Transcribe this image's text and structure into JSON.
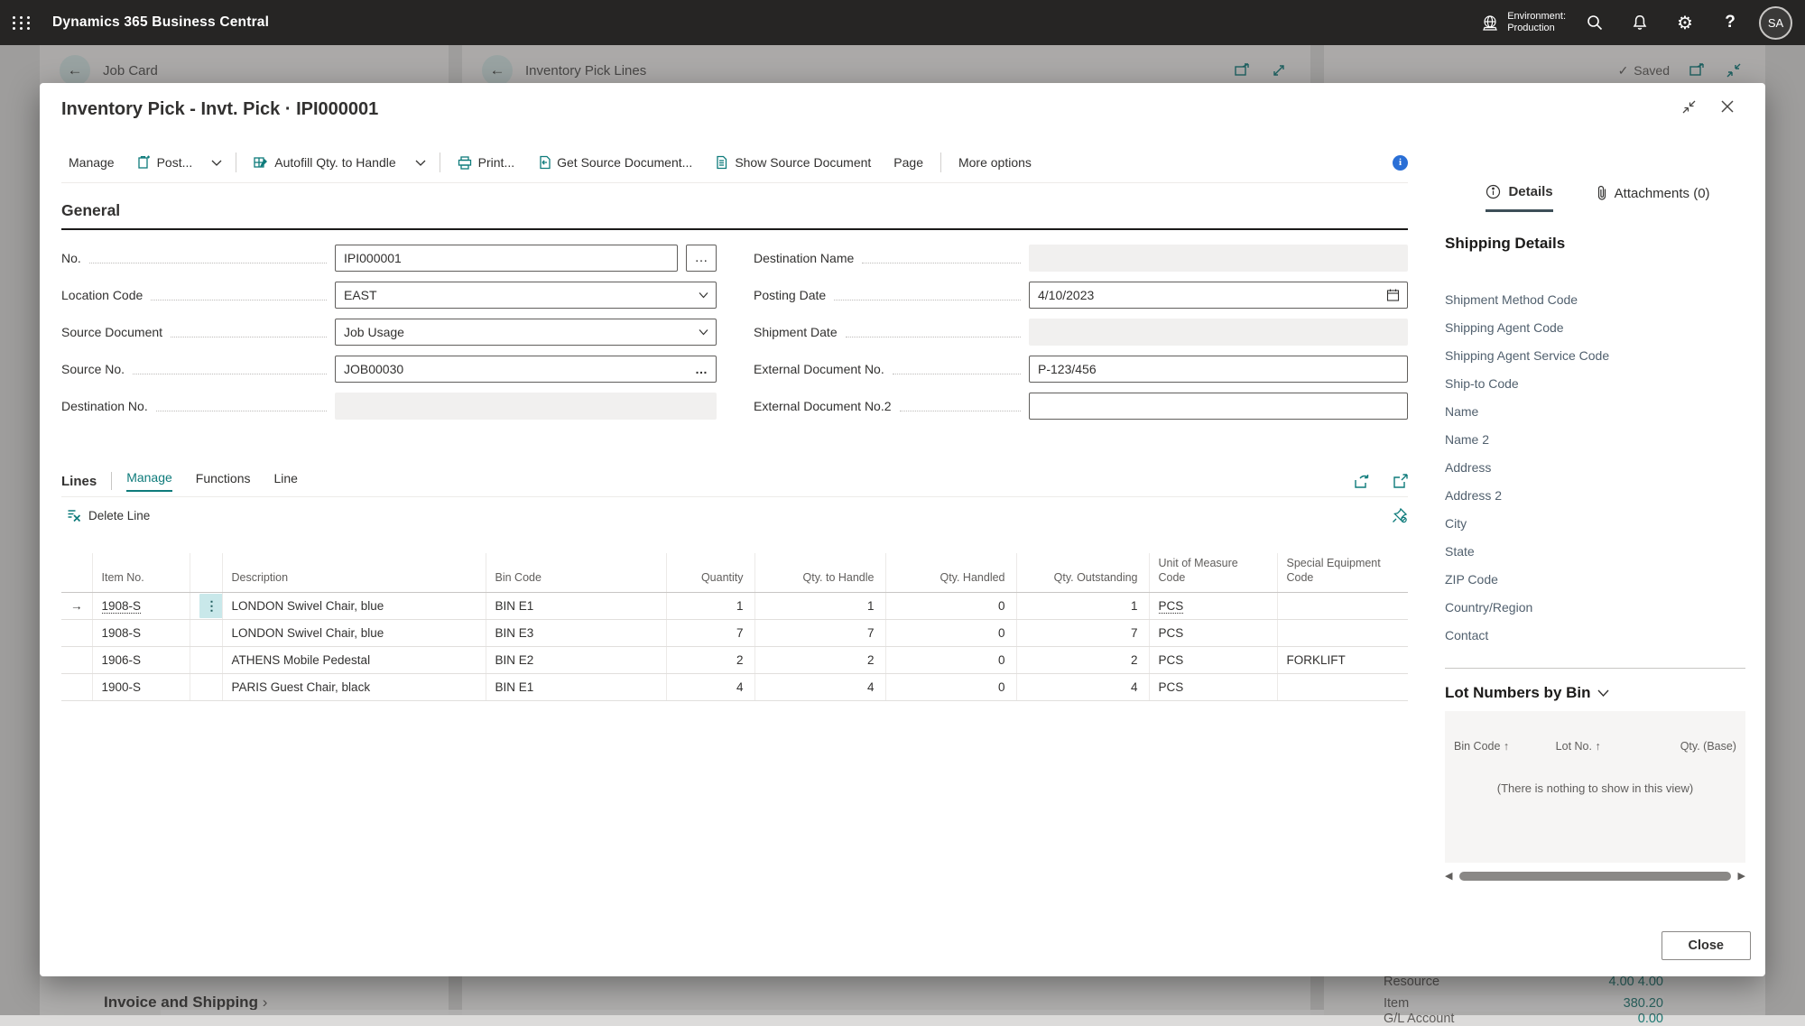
{
  "topbar": {
    "app_title": "Dynamics 365 Business Central",
    "environment_label": "Environment:",
    "environment_name": "Production",
    "avatar_initials": "SA"
  },
  "background": {
    "left_page_title": "Job Card",
    "middle_page_title": "Inventory Pick Lines",
    "saved_indicator": "Saved",
    "left_bottom_section": "Invoice and Shipping",
    "fact_rows": [
      {
        "label": "Resource",
        "value": "4.00 4.00"
      },
      {
        "label": "Item",
        "value": "380.20"
      },
      {
        "label": "G/L Account",
        "value": "0.00"
      }
    ]
  },
  "modal": {
    "title": "Inventory Pick - Invt. Pick · IPI000001",
    "toolbar": {
      "manage": "Manage",
      "post": "Post...",
      "autofill": "Autofill Qty. to Handle",
      "print": "Print...",
      "get_source": "Get Source Document...",
      "show_source": "Show Source Document",
      "page": "Page",
      "more_options": "More options"
    },
    "general": {
      "heading": "General",
      "fields": {
        "no": {
          "label": "No.",
          "value": "IPI000001"
        },
        "location_code": {
          "label": "Location Code",
          "value": "EAST"
        },
        "source_document": {
          "label": "Source Document",
          "value": "Job Usage"
        },
        "source_no": {
          "label": "Source No.",
          "value": "JOB00030"
        },
        "destination_no": {
          "label": "Destination No.",
          "value": ""
        },
        "destination_name": {
          "label": "Destination Name",
          "value": ""
        },
        "posting_date": {
          "label": "Posting Date",
          "value": "4/10/2023"
        },
        "shipment_date": {
          "label": "Shipment Date",
          "value": ""
        },
        "external_doc_no": {
          "label": "External Document No.",
          "value": "P-123/456"
        },
        "external_doc_no2": {
          "label": "External Document No.2",
          "value": ""
        }
      }
    },
    "lines": {
      "heading": "Lines",
      "tabs": {
        "manage": "Manage",
        "functions": "Functions",
        "line": "Line"
      },
      "active_tab": "Manage",
      "delete_line": "Delete Line",
      "table": {
        "columns": [
          "Item No.",
          "Description",
          "Bin Code",
          "Quantity",
          "Qty. to Handle",
          "Qty. Handled",
          "Qty. Outstanding",
          "Unit of Measure Code",
          "Special Equipment Code"
        ],
        "rows": [
          {
            "selected": true,
            "item_no": "1908-S",
            "description": "LONDON Swivel Chair, blue",
            "bin_code": "BIN E1",
            "quantity": "1",
            "qty_to_handle": "1",
            "qty_handled": "0",
            "qty_outstanding": "1",
            "uom": "PCS",
            "special_equipment": ""
          },
          {
            "selected": false,
            "item_no": "1908-S",
            "description": "LONDON Swivel Chair, blue",
            "bin_code": "BIN E3",
            "quantity": "7",
            "qty_to_handle": "7",
            "qty_handled": "0",
            "qty_outstanding": "7",
            "uom": "PCS",
            "special_equipment": ""
          },
          {
            "selected": false,
            "item_no": "1906-S",
            "description": "ATHENS Mobile Pedestal",
            "bin_code": "BIN E2",
            "quantity": "2",
            "qty_to_handle": "2",
            "qty_handled": "0",
            "qty_outstanding": "2",
            "uom": "PCS",
            "special_equipment": "FORKLIFT"
          },
          {
            "selected": false,
            "item_no": "1900-S",
            "description": "PARIS Guest Chair, black",
            "bin_code": "BIN E1",
            "quantity": "4",
            "qty_to_handle": "4",
            "qty_handled": "0",
            "qty_outstanding": "4",
            "uom": "PCS",
            "special_equipment": ""
          }
        ]
      }
    },
    "sidebar": {
      "tabs": {
        "details": "Details",
        "attachments": "Attachments (0)"
      },
      "shipping": {
        "heading": "Shipping Details",
        "labels": [
          "Shipment Method Code",
          "Shipping Agent Code",
          "Shipping Agent Service Code",
          "Ship-to Code",
          "Name",
          "Name 2",
          "Address",
          "Address 2",
          "City",
          "State",
          "ZIP Code",
          "Country/Region",
          "Contact"
        ]
      },
      "lot": {
        "heading": "Lot Numbers by Bin",
        "columns": [
          "Bin Code ↑",
          "Lot No. ↑",
          "Qty. (Base)"
        ],
        "empty_message": "(There is nothing to show in this view)"
      }
    },
    "close_label": "Close"
  },
  "colors": {
    "accent_teal": "#0e7b7b",
    "info_blue": "#2a6fd6",
    "value_teal": "#1f7a74",
    "details_underline": "#3d4f58",
    "selected_cell_chip": "#c9e8ea"
  }
}
